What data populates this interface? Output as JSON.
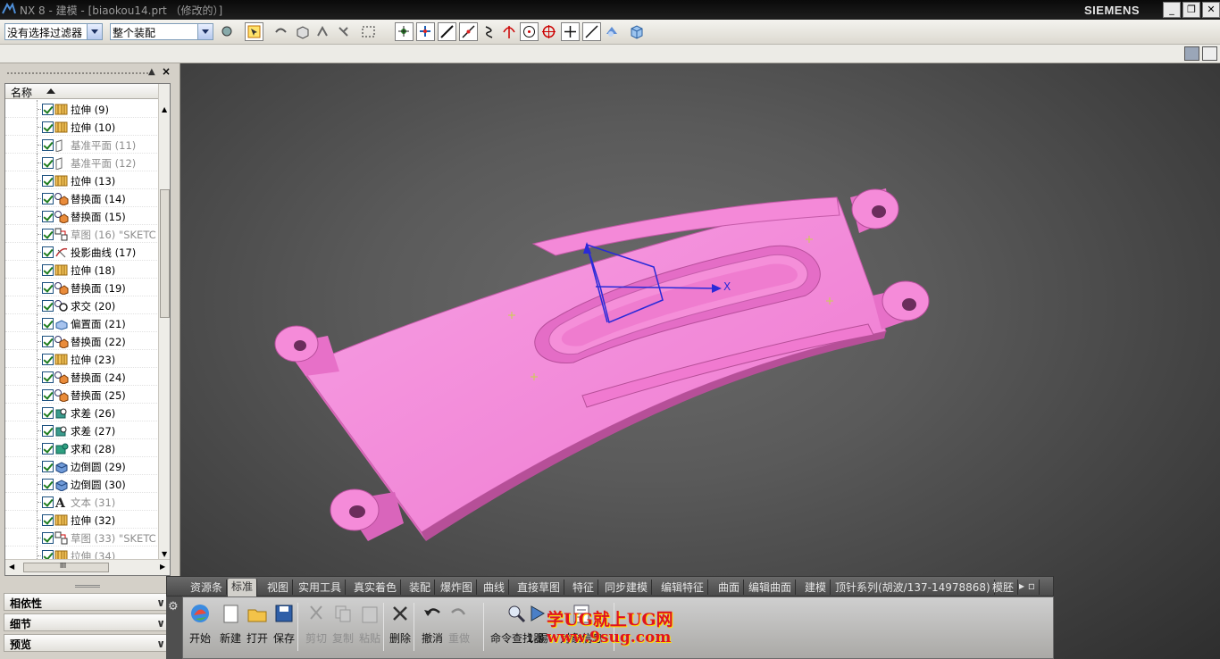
{
  "window": {
    "title": "NX 8 - 建模 - [biaokou14.prt （修改的）]",
    "brand": "SIEMENS",
    "controls": [
      "_",
      "❐",
      "✕"
    ]
  },
  "toolbar": {
    "filter_select": "没有选择过滤器",
    "scope_select": "整个装配",
    "icons": [
      "component-icon",
      "select-icon",
      "undo-select-icon",
      "cube-select-icon",
      "snap-icon",
      "snap2-icon",
      "box-select-icon",
      "point-select-icon",
      "point-icon",
      "line-icon",
      "line-arrow-icon",
      "curve-icon",
      "intersect-icon",
      "center-icon",
      "quadrant-icon",
      "plus-icon",
      "slash-icon",
      "view-icon",
      "cube-icon"
    ]
  },
  "navigator": {
    "column_header": "名称",
    "features": [
      {
        "name": "拉伸",
        "id": "(9)",
        "icon": "extrude-icon",
        "dim": false
      },
      {
        "name": "拉伸",
        "id": "(10)",
        "icon": "extrude-icon",
        "dim": false
      },
      {
        "name": "基准平面",
        "id": "(11)",
        "icon": "datum-plane-icon",
        "dim": true
      },
      {
        "name": "基准平面",
        "id": "(12)",
        "icon": "datum-plane-icon",
        "dim": true
      },
      {
        "name": "拉伸",
        "id": "(13)",
        "icon": "extrude-icon",
        "dim": false
      },
      {
        "name": "替换面",
        "id": "(14)",
        "icon": "replace-face-icon",
        "dim": false
      },
      {
        "name": "替换面",
        "id": "(15)",
        "icon": "replace-face-icon",
        "dim": false
      },
      {
        "name": "草图",
        "id": "(16) \"SKETC",
        "icon": "sketch-icon",
        "dim": true
      },
      {
        "name": "投影曲线",
        "id": "(17)",
        "icon": "project-curve-icon",
        "dim": false
      },
      {
        "name": "拉伸",
        "id": "(18)",
        "icon": "extrude-icon",
        "dim": false
      },
      {
        "name": "替换面",
        "id": "(19)",
        "icon": "replace-face-icon",
        "dim": false
      },
      {
        "name": "求交",
        "id": "(20)",
        "icon": "intersect-icon",
        "dim": false
      },
      {
        "name": "偏置面",
        "id": "(21)",
        "icon": "offset-face-icon",
        "dim": false
      },
      {
        "name": "替换面",
        "id": "(22)",
        "icon": "replace-face-icon",
        "dim": false
      },
      {
        "name": "拉伸",
        "id": "(23)",
        "icon": "extrude-icon",
        "dim": false
      },
      {
        "name": "替换面",
        "id": "(24)",
        "icon": "replace-face-icon",
        "dim": false
      },
      {
        "name": "替换面",
        "id": "(25)",
        "icon": "replace-face-icon",
        "dim": false
      },
      {
        "name": "求差",
        "id": "(26)",
        "icon": "subtract-icon",
        "dim": false
      },
      {
        "name": "求差",
        "id": "(27)",
        "icon": "subtract-icon",
        "dim": false
      },
      {
        "name": "求和",
        "id": "(28)",
        "icon": "unite-icon",
        "dim": false
      },
      {
        "name": "边倒圆",
        "id": "(29)",
        "icon": "edge-blend-icon",
        "dim": false
      },
      {
        "name": "边倒圆",
        "id": "(30)",
        "icon": "edge-blend-icon",
        "dim": false
      },
      {
        "name": "文本",
        "id": "(31)",
        "icon": "text-icon",
        "dim": true
      },
      {
        "name": "拉伸",
        "id": "(32)",
        "icon": "extrude-icon",
        "dim": false
      },
      {
        "name": "草图",
        "id": "(33) \"SKETC",
        "icon": "sketch-icon",
        "dim": true
      },
      {
        "name": "拉伸",
        "id": "(34)",
        "icon": "extrude-icon",
        "dim": true
      }
    ],
    "hscroll_label": "III",
    "panels": [
      "相依性",
      "细节",
      "预览"
    ]
  },
  "viewport": {
    "axis_label": "X",
    "colors": {
      "part": "#f07ad0",
      "part_dark": "#c95ab0",
      "wcs": "#2a2ad8"
    }
  },
  "ribbon": {
    "tabs": [
      "资源条",
      "标准",
      "视图",
      "实用工具",
      "真实着色",
      "装配",
      "爆炸图",
      "曲线",
      "直接草图",
      "特征",
      "同步建模",
      "编辑特征",
      "曲面",
      "编辑曲面",
      "建模",
      "顶针系列(胡波/137-14978868)",
      "模胚"
    ],
    "active_tab": "标准",
    "commands": [
      {
        "label": "开始",
        "icon": "start-icon",
        "enabled": true
      },
      {
        "label": "新建",
        "icon": "new-icon",
        "enabled": true
      },
      {
        "label": "打开",
        "icon": "open-icon",
        "enabled": true
      },
      {
        "label": "保存",
        "icon": "save-icon",
        "enabled": true
      },
      {
        "label": "剪切",
        "icon": "cut-icon",
        "enabled": false
      },
      {
        "label": "复制",
        "icon": "copy-icon",
        "enabled": false
      },
      {
        "label": "粘贴",
        "icon": "paste-icon",
        "enabled": false
      },
      {
        "label": "删除",
        "icon": "delete-icon",
        "enabled": true
      },
      {
        "label": "撤消",
        "icon": "undo-icon",
        "enabled": true
      },
      {
        "label": "重做",
        "icon": "redo-icon",
        "enabled": false
      },
      {
        "label": "命令查找器",
        "icon": "command-finder-icon",
        "enabled": true
      },
      {
        "label": "1 踢",
        "icon": "kick-icon",
        "enabled": true
      },
      {
        "label": "对象信息",
        "icon": "info-icon",
        "enabled": true
      }
    ]
  },
  "watermark": {
    "line1": "学UG就上UG网",
    "line2": "www.9sug.com"
  }
}
